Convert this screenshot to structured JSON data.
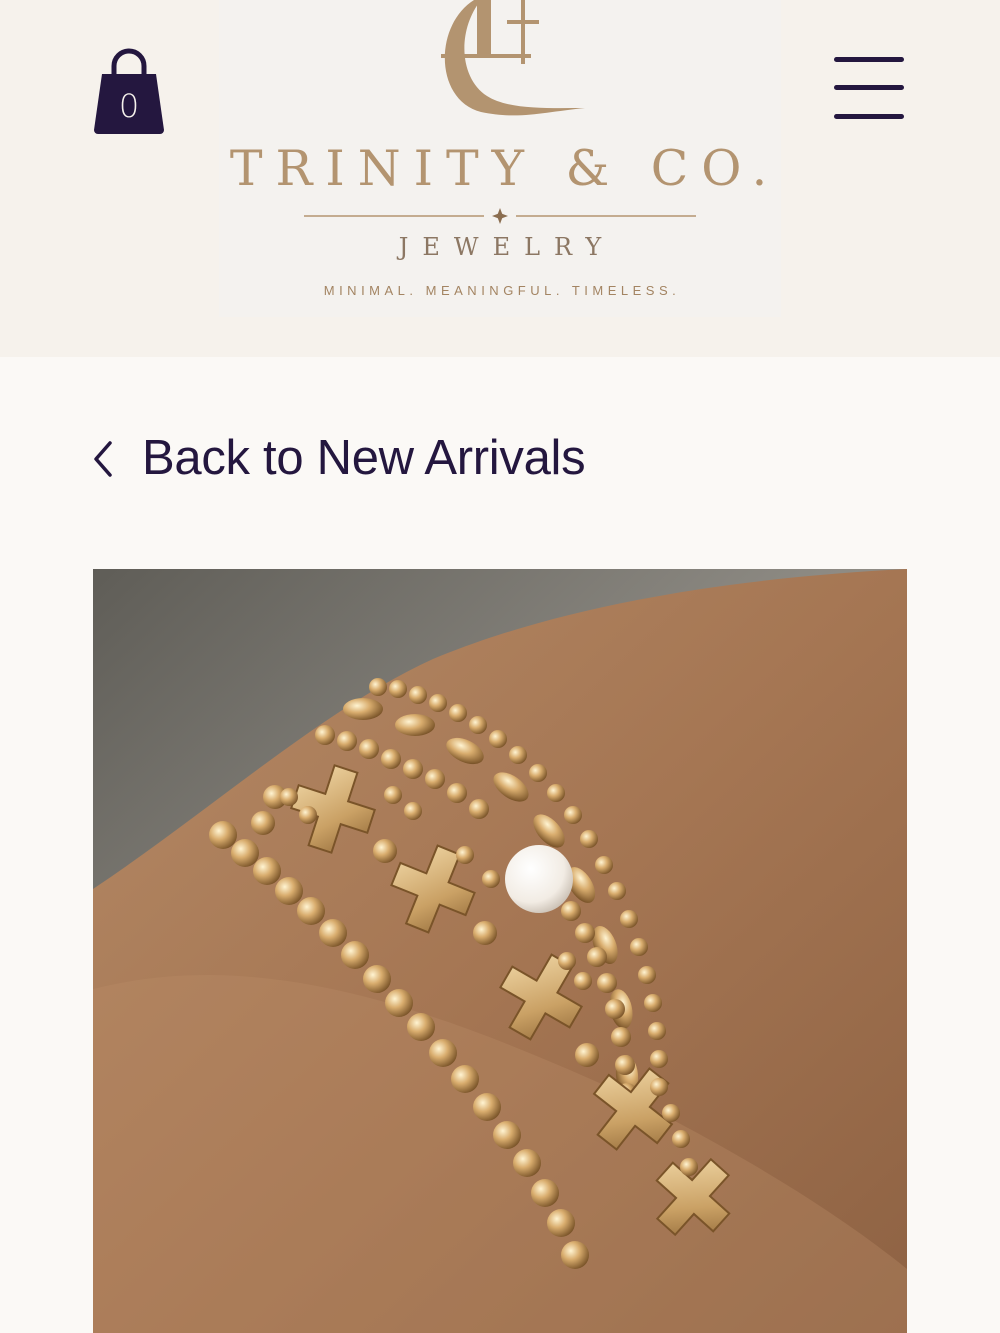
{
  "header": {
    "cart": {
      "count": "0",
      "icon": "shopping-bag-icon"
    },
    "menu": {
      "icon": "hamburger-menu-icon"
    },
    "logo": {
      "name": "TRINITY & CO.",
      "sub": "JEWELRY",
      "tagline": "MINIMAL. MEANINGFUL. TIMELESS."
    }
  },
  "nav": {
    "back_label": "Back to New Arrivals",
    "back_icon": "chevron-left-icon"
  },
  "colors": {
    "header_bg": "#f6f2ec",
    "page_bg": "#fbf9f6",
    "brand_dark": "#24173f",
    "gold": "#b39470"
  }
}
